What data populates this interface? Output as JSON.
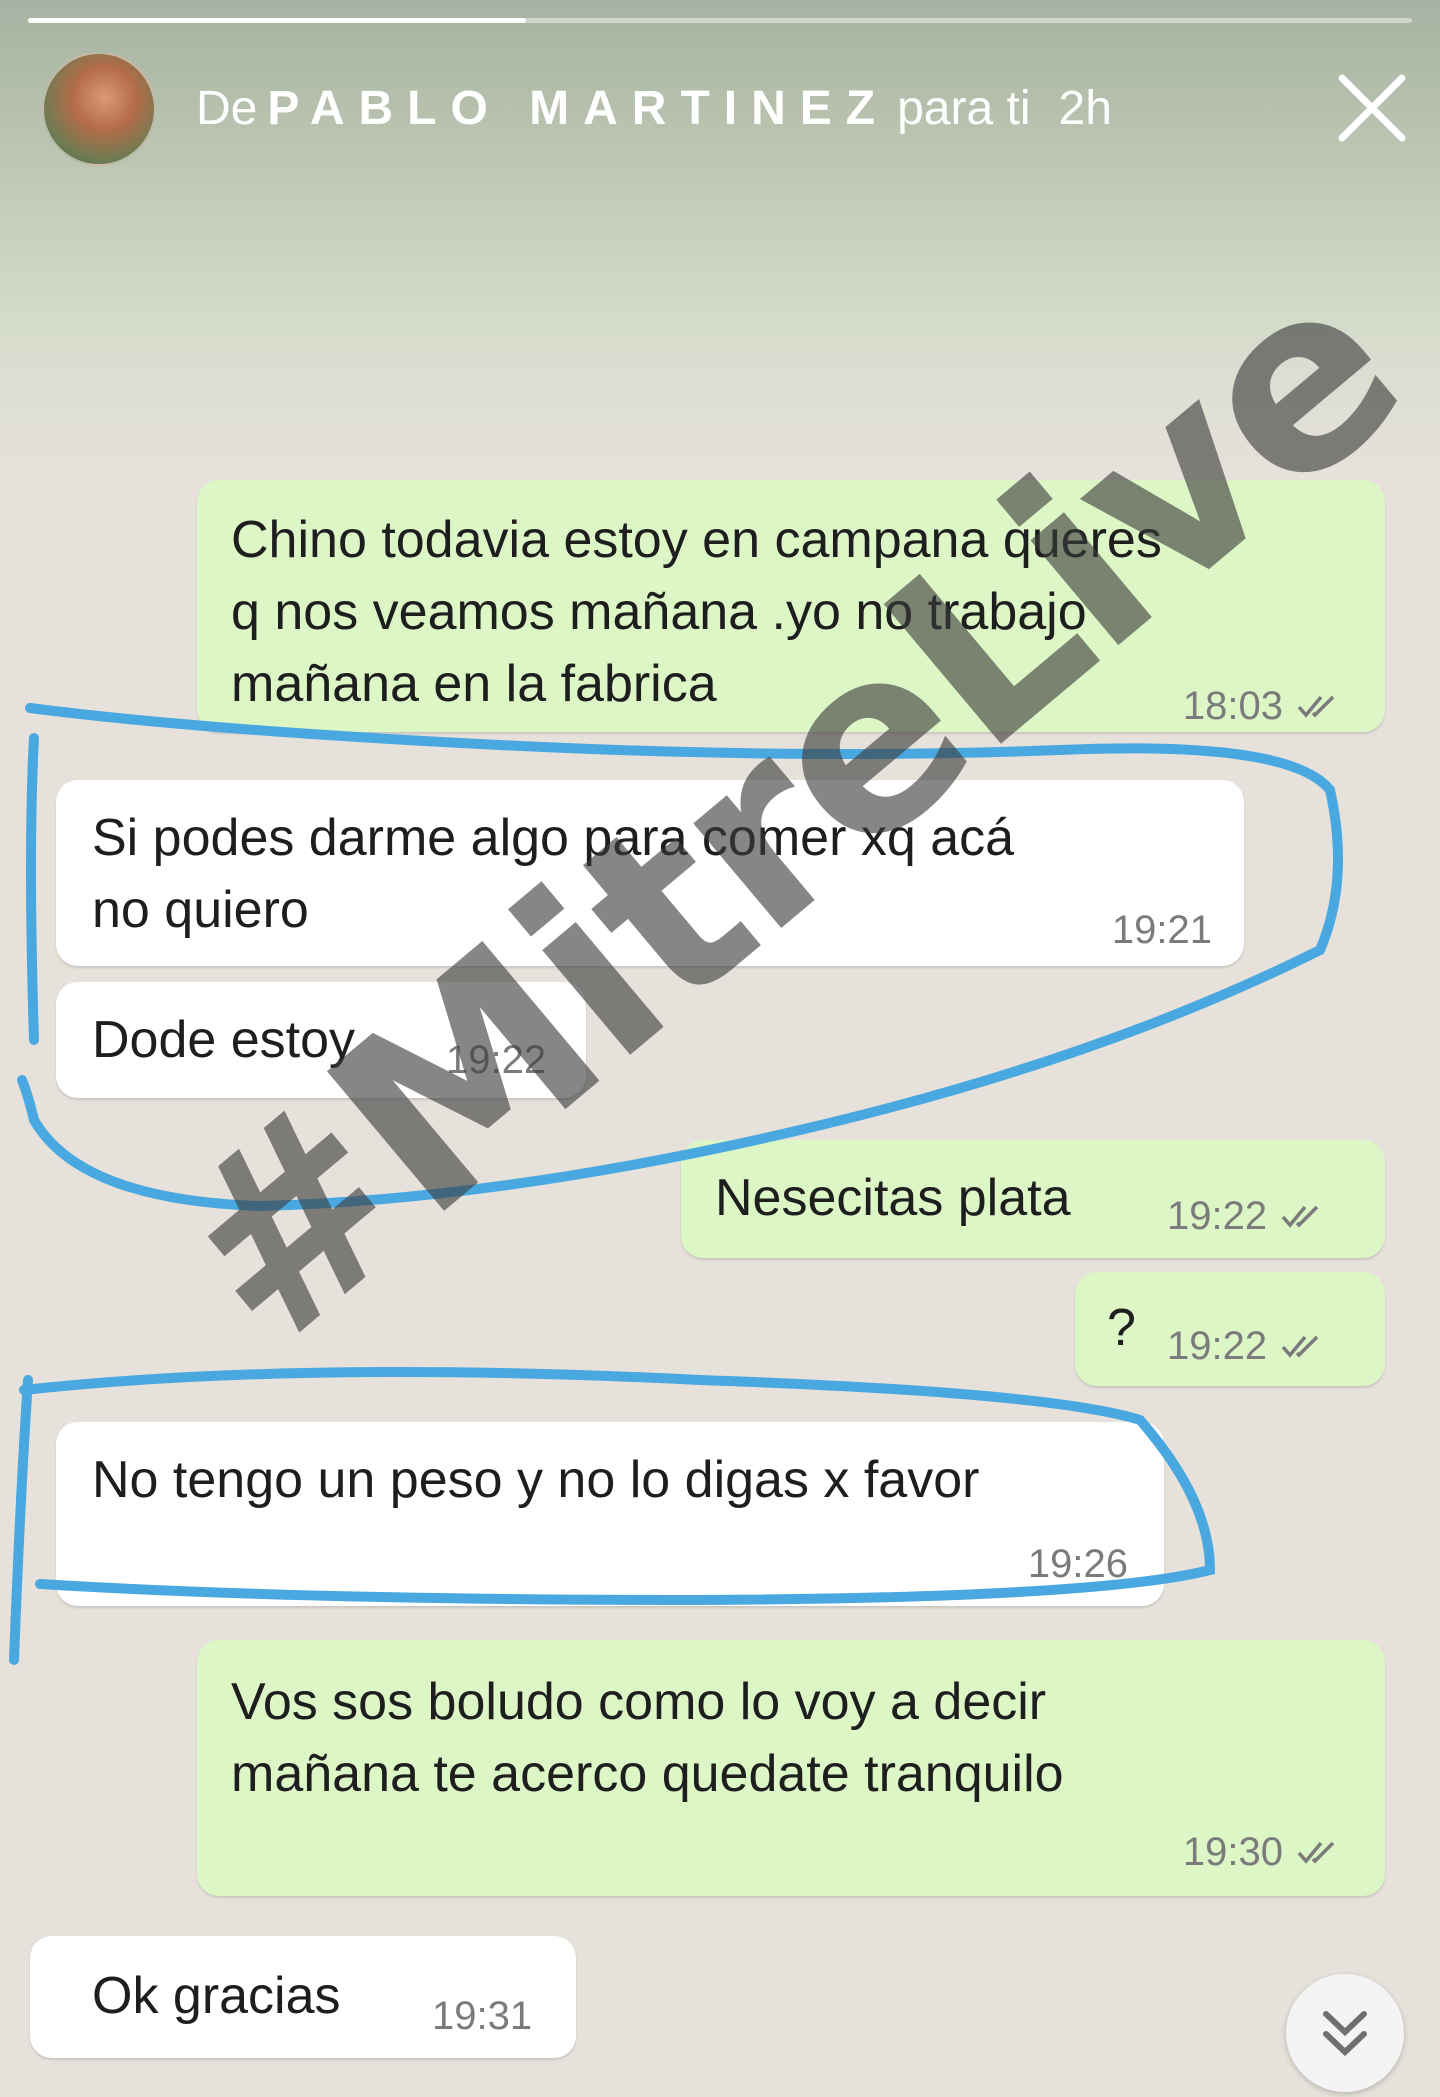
{
  "story": {
    "progress_fraction": 0.36,
    "prefix": "De",
    "sender": "PABLO MARTINEZ",
    "suffix": "para ti",
    "age": "2h",
    "icons": {
      "avatar": "avatar",
      "close": "close-icon"
    }
  },
  "messages": [
    {
      "dir": "out",
      "text": "Chino todavia estoy en campana queres q nos veamos mañana .yo no trabajo mañana en la fabrica",
      "time": "18:03",
      "ticks": true
    },
    {
      "dir": "in",
      "text": "Si podes darme algo para comer xq acá no quiero",
      "time": "19:21",
      "ticks": false
    },
    {
      "dir": "in",
      "text": "Dode estoy",
      "time": "19:22",
      "ticks": false
    },
    {
      "dir": "out",
      "text": "Nesecitas plata",
      "time": "19:22",
      "ticks": true
    },
    {
      "dir": "out",
      "text": "?",
      "time": "19:22",
      "ticks": true
    },
    {
      "dir": "in",
      "text": "No tengo un peso y no lo digas x favor",
      "time": "19:26",
      "ticks": false
    },
    {
      "dir": "out",
      "text": "Vos sos boludo como lo voy a decir mañana te acerco quedate tranquilo",
      "time": "19:30",
      "ticks": true
    },
    {
      "dir": "in",
      "text": "Ok gracias",
      "time": "19:31",
      "ticks": false
    }
  ],
  "lines": {
    "m0": [
      "Chino todavia estoy en campana queres",
      "q nos veamos mañana .yo no trabajo",
      "mañana en la fabrica"
    ],
    "m1": [
      "Si podes darme algo para comer xq acá",
      "no quiero"
    ],
    "m6": [
      "Vos sos boludo como lo voy a decir",
      "mañana te acerco quedate tranquilo"
    ]
  },
  "watermark": "#MitreLive",
  "colors": {
    "outgoing_bubble": "#dcf6c6",
    "incoming_bubble": "#ffffff",
    "highlight_stroke": "#4aa8e0",
    "tick_color": "#7b7b7b"
  },
  "scroll_button_icon": "double-chevron-down-icon"
}
